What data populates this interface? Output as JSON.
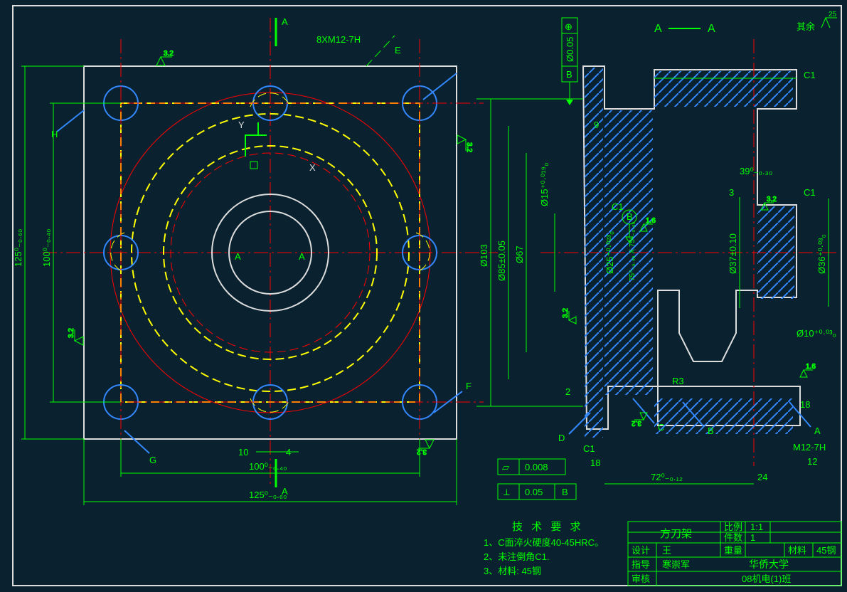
{
  "plan_view": {
    "outer_sq_lbl": "125⁰₋₀.₆₀",
    "inner_sq_lbl": "100⁰₋₀.₄₀",
    "outer_sq_lbl_h": "125⁰₋₀.₆₀",
    "inner_sq_lbl_h": "100⁰₋₀.₄₀",
    "hole_spec": "8XM12-7H",
    "dim10": "10",
    "dim4": "4",
    "axis_x": "X",
    "axis_y": "Y",
    "axis_A": "A",
    "axis_Arep": "A",
    "leaders": {
      "E": "E",
      "F": "F",
      "G": "G",
      "H": "H"
    },
    "section_top": "A",
    "section_bot": "A",
    "surf": "3.2"
  },
  "section_view": {
    "d103": "Ø103",
    "d85": "Ø85±0.05",
    "d67": "Ø67",
    "d25": "Ø25⁺⁰·⁰²³₀",
    "d15": "Ø15⁺⁰·⁰¹⁹₀",
    "d37": "Ø37±0.10",
    "d36": "Ø36⁺⁰·⁰³₀",
    "d10": "Ø10⁺⁰·⁰³₀",
    "dim9": "9",
    "dim3": "3",
    "dim2": "2",
    "dim18": "18",
    "dim18r": "18",
    "dim12": "12",
    "dim24": "24",
    "dim72": "72⁰₋₀.₁₂",
    "dim39": "39⁰₋₀.₃₀",
    "chamferC1": "C1",
    "chamferC1_2": "C1",
    "chamferC1_3": "C1",
    "chamferC1_4": "C1",
    "radiusR3": "R3",
    "feat75": "75⁰₋₀.₄₀ X 75⁰₋₀.₄₀",
    "thread": "M12-7H",
    "datumB": "B",
    "datumB_box": "B",
    "surfA": "A",
    "surfB": "B",
    "surfC": "C",
    "surfD": "D",
    "surf16": "1.6",
    "surf32": "3.2",
    "gtol1": {
      "sym": "⊕",
      "val": "Ø0.05",
      "ref": "B"
    },
    "gtol2": {
      "sym": "▱",
      "val": "0.008"
    },
    "gtol3": {
      "sym": "⟂",
      "val": "0.05",
      "ref": "B"
    }
  },
  "section_label": {
    "left": "A",
    "right": "A",
    "dash": "——"
  },
  "default_surf": {
    "prefix": "其余",
    "val": "25"
  },
  "tech_req": {
    "title": "技  术  要  求",
    "items": [
      "1、C面淬火硬度40-45HRC。",
      "2、未注倒角C1.",
      "3、材料: 45钢"
    ]
  },
  "title_block": {
    "name": "方刀架",
    "design_lbl": "设计",
    "design_val": "王",
    "guide_lbl": "指导",
    "guide_val": "寒崇军",
    "check_lbl": "审核",
    "scale_lbl": "比例",
    "scale_val": "1:1",
    "count_lbl": "件数",
    "count_val": "1",
    "weight_lbl": "重量",
    "material_lbl": "材料",
    "material_val": "45钢",
    "school": "华侨大学",
    "class": "08机电(1)班"
  }
}
